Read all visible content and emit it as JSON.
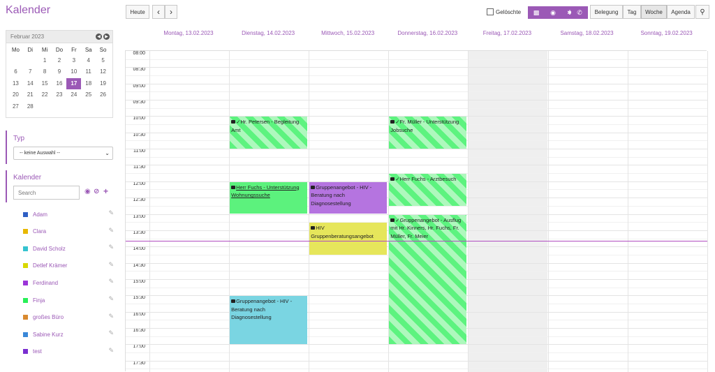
{
  "header": {
    "title": "Kalender",
    "today_label": "Heute",
    "prev_icon": "‹",
    "next_icon": "›",
    "deleted_label": "Gelöschte",
    "filter_buttons": [
      "calendar-icon",
      "mask-icon",
      "pin-icon",
      "phone-icon"
    ],
    "views": [
      "Belegung",
      "Tag",
      "Woche",
      "Agenda"
    ],
    "active_view": "Woche",
    "search_icon": "search-icon"
  },
  "mini_calendar": {
    "month_label": "Februar 2023",
    "weekdays": [
      "Mo",
      "Di",
      "Mi",
      "Do",
      "Fr",
      "Sa",
      "So"
    ],
    "days": [
      "",
      "",
      "1",
      "2",
      "3",
      "4",
      "5",
      "6",
      "7",
      "8",
      "9",
      "10",
      "11",
      "12",
      "13",
      "14",
      "15",
      "16",
      "17",
      "18",
      "19",
      "20",
      "21",
      "22",
      "23",
      "24",
      "25",
      "26",
      "27",
      "28"
    ],
    "selected_day": "17"
  },
  "type_section": {
    "title": "Typ",
    "select_value": "-- keine Auswahl --"
  },
  "calendar_section": {
    "title": "Kalender",
    "search_placeholder": "Search",
    "items": [
      {
        "name": "Adam",
        "color": "#2f5fc4"
      },
      {
        "name": "Clara",
        "color": "#e8b800"
      },
      {
        "name": "David Scholz",
        "color": "#35c3d0"
      },
      {
        "name": "Detlef Krämer",
        "color": "#d8d800"
      },
      {
        "name": "Ferdinand",
        "color": "#9b35d8"
      },
      {
        "name": "Finja",
        "color": "#28ef57"
      },
      {
        "name": "großes Büro",
        "color": "#d98a30"
      },
      {
        "name": "Sabine Kurz",
        "color": "#3a88d8"
      },
      {
        "name": "test",
        "color": "#7a2fd0"
      }
    ]
  },
  "week": {
    "days": [
      "Montag, 13.02.2023",
      "Dienstag, 14.02.2023",
      "Mittwoch, 15.02.2023",
      "Donnerstag, 16.02.2023",
      "Freitag, 17.02.2023",
      "Samstag, 18.02.2023",
      "Sonntag, 19.02.2023"
    ],
    "times": [
      "08:00",
      "08:30",
      "09:00",
      "09:30",
      "10:00",
      "10:30",
      "11:00",
      "11:30",
      "12:00",
      "12:30",
      "13:00",
      "13:30",
      "14:00",
      "14:30",
      "15:00",
      "15:30",
      "16:00",
      "16:30",
      "17:00",
      "17:30"
    ]
  },
  "events": [
    {
      "day": 1,
      "start": "10:00",
      "end": "11:00",
      "style": "hatch",
      "underline": false,
      "text": "✓Hr. Petersen - Begleitung Amt"
    },
    {
      "day": 3,
      "start": "10:00",
      "end": "11:00",
      "style": "hatch",
      "underline": false,
      "text": "✓Fr. Müller - Unterstützung Jobsuche"
    },
    {
      "day": 3,
      "start": "11:45",
      "end": "12:45",
      "style": "hatch",
      "underline": false,
      "text": "✓Herr Fuchs - Arztbesuch"
    },
    {
      "day": 1,
      "start": "12:00",
      "end": "13:00",
      "style": "g",
      "underline": true,
      "text": "Herr Fuchs - Unterstützung Wohnungssuche"
    },
    {
      "day": 2,
      "start": "12:00",
      "end": "13:00",
      "style": "p",
      "underline": false,
      "text": "Gruppenangebot - HIV - Beratung nach Diagnosestellung"
    },
    {
      "day": 3,
      "start": "13:00",
      "end": "17:00",
      "style": "hatch",
      "underline": false,
      "text": "✓Gruppenangebot - Ausflug mit Hr. Kinners, Hr. Fuchs, Fr. Müller, Fr. Meier"
    },
    {
      "day": 2,
      "start": "13:15",
      "end": "14:15",
      "style": "y",
      "underline": false,
      "text": "HIV Gruppenberatungsangebot"
    },
    {
      "day": 1,
      "start": "15:30",
      "end": "17:00",
      "style": "c",
      "underline": false,
      "text": "Gruppenangebot - HIV - Beratung nach Diagnosestellung"
    }
  ]
}
